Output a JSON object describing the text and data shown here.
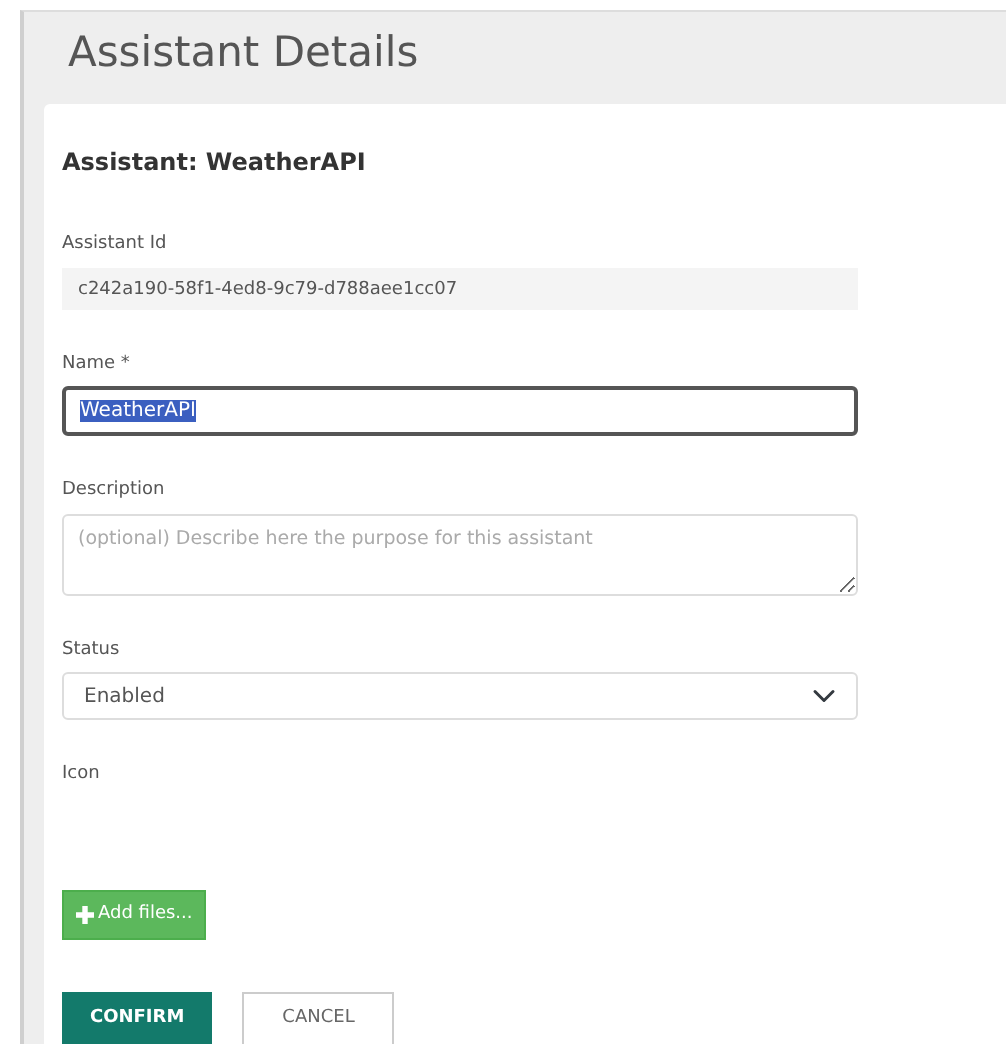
{
  "page": {
    "title": "Assistant Details"
  },
  "form": {
    "heading": "Assistant: WeatherAPI",
    "fields": [
      {
        "kind": "readonly",
        "label": "Assistant Id",
        "value": "c242a190-58f1-4ed8-9c79-d788aee1cc07"
      },
      {
        "kind": "text",
        "label": "Name *",
        "value": "WeatherAPI",
        "focused": true,
        "text_selected": true
      },
      {
        "kind": "textarea",
        "label": "Description",
        "placeholder": "(optional) Describe here the purpose for this assistant"
      },
      {
        "kind": "select",
        "label": "Status",
        "value": "Enabled"
      },
      {
        "kind": "upload",
        "label": "Icon",
        "button": "Add files..."
      }
    ],
    "buttons": [
      {
        "kind": "primary",
        "label": "CONFIRM"
      },
      {
        "kind": "secondary",
        "label": "CANCEL"
      }
    ]
  }
}
